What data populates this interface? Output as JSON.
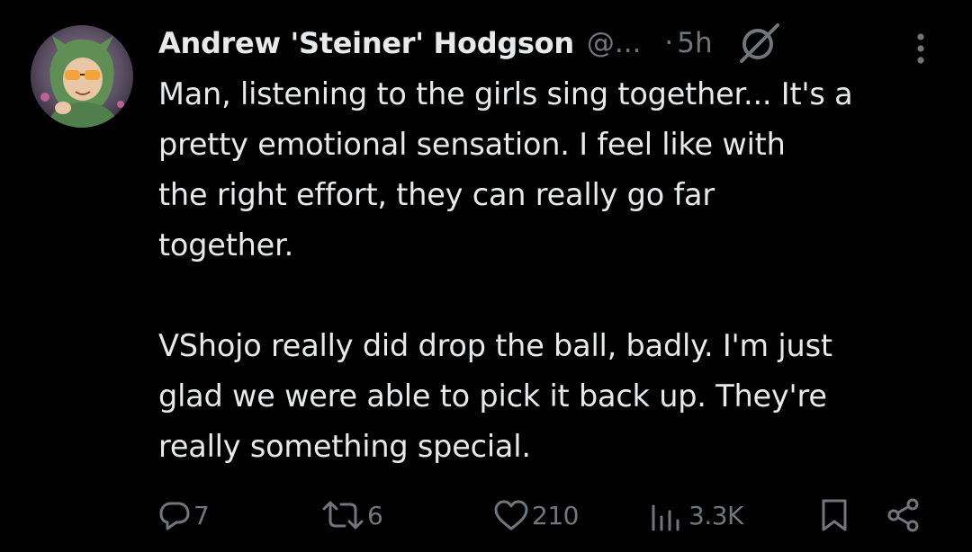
{
  "author": {
    "display_name": "Andrew 'Steiner' Hodgson",
    "handle": "@...",
    "separator": "·",
    "time": "5h"
  },
  "tweet": {
    "paragraph_1_lines": [
      "Man, listening to the girls sing together... It's a",
      "pretty emotional sensation. I feel like with",
      "the right effort, they can really go far",
      "together."
    ],
    "paragraph_2_lines": [
      "VShojo really did drop the ball, badly. I'm just",
      "glad we were able to pick it back up. They're",
      "really something special."
    ]
  },
  "actions": {
    "replies": "7",
    "reposts": "6",
    "likes": "210",
    "views": "3.3K"
  },
  "icons": {
    "header": [
      "grok-icon",
      "more-options-icon"
    ],
    "actions": [
      "reply-icon",
      "repost-icon",
      "like-icon",
      "views-icon",
      "bookmark-icon",
      "share-icon"
    ]
  },
  "colors": {
    "background": "#000000",
    "text_primary": "#e7e9ea",
    "text_secondary": "#71767b"
  }
}
